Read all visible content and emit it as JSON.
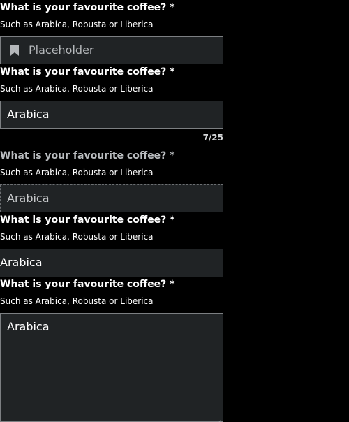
{
  "fields": [
    {
      "label": "What is your favourite coffee? *",
      "hint": "Such as Arabica, Robusta or Liberica",
      "placeholder": "Placeholder",
      "icon": "bookmark-icon"
    },
    {
      "label": "What is your favourite coffee? *",
      "hint": "Such as Arabica, Robusta or Liberica",
      "value": "Arabica",
      "counter": "7/25"
    },
    {
      "label": "What is your favourite coffee? *",
      "hint": "Such as Arabica, Robusta or Liberica",
      "value": "Arabica",
      "state": "disabled"
    },
    {
      "label": "What is your favourite coffee? *",
      "hint": "Such as Arabica, Robusta or Liberica",
      "value": "Arabica",
      "state": "borderless"
    },
    {
      "label": "What is your favourite coffee? *",
      "hint": "Such as Arabica, Robusta or Liberica",
      "value": "Arabica",
      "type": "textarea"
    }
  ],
  "colors": {
    "background": "#000000",
    "field_background": "#202325",
    "border": "#7c7f82",
    "text": "#ffffff",
    "muted_text": "#b9bcbf"
  }
}
